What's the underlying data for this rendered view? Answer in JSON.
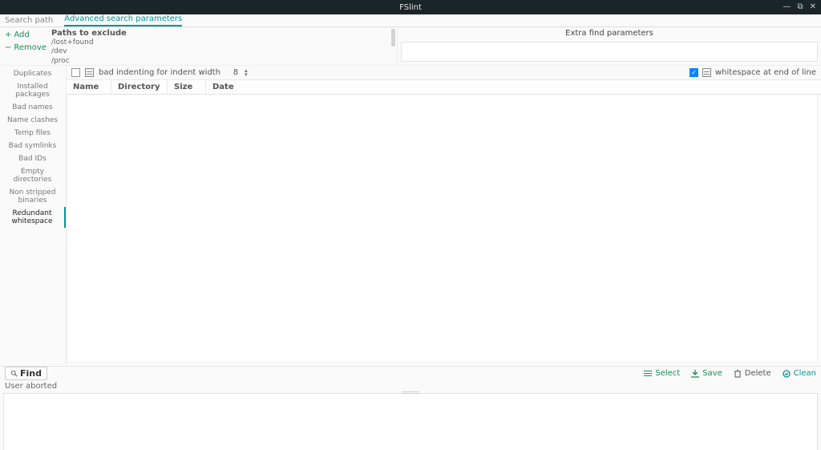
{
  "window": {
    "title": "FSlint"
  },
  "tabs": {
    "items": [
      {
        "label": "Search path",
        "active": false
      },
      {
        "label": "Advanced search parameters",
        "active": true
      }
    ]
  },
  "pathsPanel": {
    "addLabel": "Add",
    "removeLabel": "Remove",
    "heading": "Paths to exclude",
    "paths": [
      "/lost+found",
      "/dev",
      "/proc"
    ]
  },
  "extraParams": {
    "heading": "Extra find parameters",
    "value": ""
  },
  "sidebar": {
    "items": [
      "Duplicates",
      "Installed packages",
      "Bad names",
      "Name clashes",
      "Temp files",
      "Bad symlinks",
      "Bad IDs",
      "Empty directories",
      "Non stripped binaries",
      "Redundant whitespace"
    ],
    "selectedIndex": 9
  },
  "options": {
    "indentCheck": {
      "checked": false,
      "label": "bad indenting for indent width",
      "value": "8"
    },
    "eolCheck": {
      "checked": true,
      "label": "whitespace at end of line"
    }
  },
  "table": {
    "columns": [
      "Name",
      "Directory",
      "Size",
      "Date"
    ]
  },
  "toolbar": {
    "find": "Find",
    "select": "Select",
    "save": "Save",
    "delete": "Delete",
    "clean": "Clean"
  },
  "status": {
    "text": "User aborted"
  }
}
